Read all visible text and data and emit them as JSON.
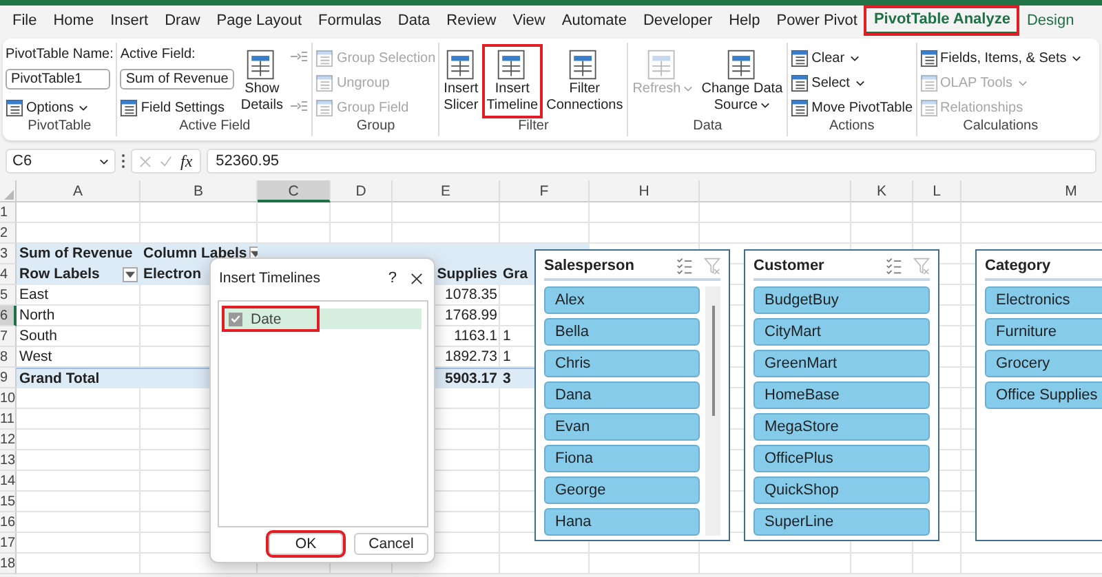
{
  "tabs": [
    {
      "label": "File",
      "selected": false,
      "contextual": false,
      "highlighted": false
    },
    {
      "label": "Home",
      "selected": false,
      "contextual": false,
      "highlighted": false
    },
    {
      "label": "Insert",
      "selected": false,
      "contextual": false,
      "highlighted": false
    },
    {
      "label": "Draw",
      "selected": false,
      "contextual": false,
      "highlighted": false
    },
    {
      "label": "Page Layout",
      "selected": false,
      "contextual": false,
      "highlighted": false
    },
    {
      "label": "Formulas",
      "selected": false,
      "contextual": false,
      "highlighted": false
    },
    {
      "label": "Data",
      "selected": false,
      "contextual": false,
      "highlighted": false
    },
    {
      "label": "Review",
      "selected": false,
      "contextual": false,
      "highlighted": false
    },
    {
      "label": "View",
      "selected": false,
      "contextual": false,
      "highlighted": false
    },
    {
      "label": "Automate",
      "selected": false,
      "contextual": false,
      "highlighted": false
    },
    {
      "label": "Developer",
      "selected": false,
      "contextual": false,
      "highlighted": false
    },
    {
      "label": "Help",
      "selected": false,
      "contextual": false,
      "highlighted": false
    },
    {
      "label": "Power Pivot",
      "selected": false,
      "contextual": false,
      "highlighted": false
    },
    {
      "label": "PivotTable Analyze",
      "selected": true,
      "contextual": true,
      "highlighted": true
    },
    {
      "label": "Design",
      "selected": false,
      "contextual": true,
      "highlighted": false
    }
  ],
  "ribbon": {
    "groups": [
      {
        "label": "PivotTable",
        "columns": [
          [
            {
              "kind": "label",
              "text": "PivotTable Name:"
            },
            {
              "kind": "field",
              "value": "PivotTable1"
            },
            {
              "kind": "small",
              "text": "Options",
              "caret": true,
              "disabled": false,
              "highlighted": false
            }
          ]
        ]
      },
      {
        "label": "Active Field",
        "columns": [
          [
            {
              "kind": "label",
              "text": "Active Field:"
            },
            {
              "kind": "field",
              "value": "Sum of Revenue"
            },
            {
              "kind": "small",
              "text": "Field Settings",
              "caret": false,
              "disabled": false,
              "highlighted": false
            }
          ],
          [
            {
              "kind": "large",
              "text": "Show\nDetails",
              "caret": false,
              "disabled": false,
              "highlighted": false
            }
          ],
          [
            {
              "kind": "mini",
              "disabled": true,
              "highlighted": false
            },
            {
              "kind": "mini",
              "disabled": true,
              "highlighted": false
            }
          ]
        ]
      },
      {
        "label": "Group",
        "columns": [
          [
            {
              "kind": "small",
              "text": "Group Selection",
              "caret": false,
              "disabled": true,
              "highlighted": false
            },
            {
              "kind": "small",
              "text": "Ungroup",
              "caret": false,
              "disabled": true,
              "highlighted": false
            },
            {
              "kind": "small",
              "text": "Group Field",
              "caret": false,
              "disabled": true,
              "highlighted": false
            }
          ]
        ]
      },
      {
        "label": "Filter",
        "columns": [
          [
            {
              "kind": "large",
              "text": "Insert\nSlicer",
              "caret": false,
              "disabled": false,
              "highlighted": false
            }
          ],
          [
            {
              "kind": "large",
              "text": "Insert\nTimeline",
              "caret": false,
              "disabled": false,
              "highlighted": true
            }
          ],
          [
            {
              "kind": "large",
              "text": "Filter\nConnections",
              "caret": false,
              "disabled": false,
              "highlighted": false
            }
          ]
        ]
      },
      {
        "label": "Data",
        "columns": [
          [
            {
              "kind": "large",
              "text": "Refresh",
              "caret": true,
              "disabled": true,
              "highlighted": false
            }
          ],
          [
            {
              "kind": "large",
              "text": "Change Data\nSource",
              "caret": true,
              "disabled": false,
              "highlighted": false
            }
          ]
        ]
      },
      {
        "label": "Actions",
        "columns": [
          [
            {
              "kind": "small",
              "text": "Clear",
              "caret": true,
              "disabled": false,
              "highlighted": false
            },
            {
              "kind": "small",
              "text": "Select",
              "caret": true,
              "disabled": false,
              "highlighted": false
            },
            {
              "kind": "small",
              "text": "Move PivotTable",
              "caret": false,
              "disabled": false,
              "highlighted": false
            }
          ]
        ]
      },
      {
        "label": "Calculations",
        "columns": [
          [
            {
              "kind": "small",
              "text": "Fields, Items, & Sets",
              "caret": true,
              "disabled": false,
              "highlighted": false
            },
            {
              "kind": "small",
              "text": "OLAP Tools",
              "caret": true,
              "disabled": true,
              "highlighted": false
            },
            {
              "kind": "small",
              "text": "Relationships",
              "caret": false,
              "disabled": true,
              "highlighted": false
            }
          ]
        ]
      }
    ]
  },
  "formula_bar": {
    "name_box": "C6",
    "function_label": "fx",
    "value": "52360.95"
  },
  "sheet": {
    "columns": [
      {
        "label": "A",
        "selected": false
      },
      {
        "label": "B",
        "selected": false
      },
      {
        "label": "C",
        "selected": true
      },
      {
        "label": "D",
        "selected": false
      },
      {
        "label": "E",
        "selected": false
      },
      {
        "label": "F",
        "selected": false
      },
      {
        "label": "H",
        "selected": false
      },
      {
        "label": "K",
        "selected": false
      },
      {
        "label": "L",
        "selected": false
      },
      {
        "label": "M",
        "selected": false
      }
    ],
    "rows": [
      {
        "number": "1",
        "selected": false
      },
      {
        "number": "2",
        "selected": false
      },
      {
        "number": "3",
        "selected": false,
        "kind": "header",
        "label": "Sum of Revenue",
        "column_b": "Column Labels",
        "column_b_filter": true
      },
      {
        "number": "4",
        "selected": false,
        "kind": "header",
        "label": "Row Labels",
        "label_filter": true,
        "column_b": "Electron",
        "column_e": "Supplies",
        "column_f": "Gra"
      },
      {
        "number": "5",
        "selected": false,
        "kind": "data",
        "label": "East",
        "column_e": "1078.35"
      },
      {
        "number": "6",
        "selected": true,
        "kind": "data",
        "label": "North",
        "column_e": "1768.99"
      },
      {
        "number": "7",
        "selected": false,
        "kind": "data",
        "label": "South",
        "column_e": "1163.1",
        "column_f": "1"
      },
      {
        "number": "8",
        "selected": false,
        "kind": "data",
        "label": "West",
        "column_e": "1892.73",
        "column_f": "1"
      },
      {
        "number": "9",
        "selected": false,
        "kind": "total",
        "label": "Grand Total",
        "column_e": "5903.17",
        "column_f": "3"
      },
      {
        "number": "10",
        "selected": false
      },
      {
        "number": "11",
        "selected": false
      },
      {
        "number": "12",
        "selected": false
      },
      {
        "number": "13",
        "selected": false
      },
      {
        "number": "14",
        "selected": false
      },
      {
        "number": "15",
        "selected": false
      },
      {
        "number": "16",
        "selected": false
      },
      {
        "number": "17",
        "selected": false
      },
      {
        "number": "18",
        "selected": false
      }
    ]
  },
  "dialog": {
    "title": "Insert Timelines",
    "help": "?",
    "items": [
      {
        "label": "Date",
        "checked": true,
        "selected": true,
        "highlighted": true
      }
    ],
    "buttons": [
      {
        "label": "OK",
        "highlighted": true
      },
      {
        "label": "Cancel",
        "highlighted": false
      }
    ]
  },
  "slicers": [
    {
      "title": "Salesperson",
      "header_icons": true,
      "scrollbar": true,
      "items": [
        {
          "label": "Alex",
          "selected": true
        },
        {
          "label": "Bella",
          "selected": true
        },
        {
          "label": "Chris",
          "selected": true
        },
        {
          "label": "Dana",
          "selected": true
        },
        {
          "label": "Evan",
          "selected": true
        },
        {
          "label": "Fiona",
          "selected": true
        },
        {
          "label": "George",
          "selected": true
        },
        {
          "label": "Hana",
          "selected": true
        }
      ]
    },
    {
      "title": "Customer",
      "header_icons": true,
      "scrollbar": false,
      "items": [
        {
          "label": "BudgetBuy",
          "selected": true
        },
        {
          "label": "CityMart",
          "selected": true
        },
        {
          "label": "GreenMart",
          "selected": true
        },
        {
          "label": "HomeBase",
          "selected": true
        },
        {
          "label": "MegaStore",
          "selected": true
        },
        {
          "label": "OfficePlus",
          "selected": true
        },
        {
          "label": "QuickShop",
          "selected": true
        },
        {
          "label": "SuperLine",
          "selected": true
        }
      ]
    },
    {
      "title": "Category",
      "header_icons": false,
      "scrollbar": false,
      "items": [
        {
          "label": "Electronics",
          "selected": true
        },
        {
          "label": "Furniture",
          "selected": true
        },
        {
          "label": "Grocery",
          "selected": true
        },
        {
          "label": "Office Supplies",
          "selected": true
        }
      ]
    }
  ]
}
